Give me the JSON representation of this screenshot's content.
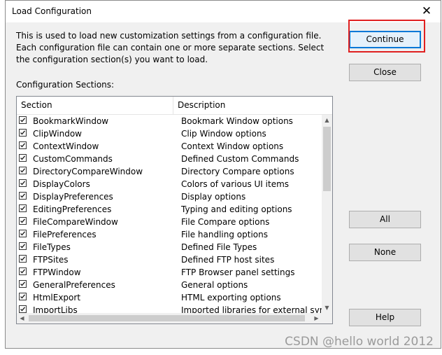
{
  "dialog": {
    "title": "Load Configuration",
    "description": "This is used to load new customization settings from a configuration file. Each configuration file can contain one or more separate sections. Select the configuration section(s) you want to load.",
    "sections_label": "Configuration Sections:",
    "columns": [
      "Section",
      "Description"
    ],
    "rows": [
      {
        "section": "BookmarkWindow",
        "description": "Bookmark Window options",
        "checked": true
      },
      {
        "section": "ClipWindow",
        "description": "Clip Window options",
        "checked": true
      },
      {
        "section": "ContextWindow",
        "description": "Context Window options",
        "checked": true
      },
      {
        "section": "CustomCommands",
        "description": "Defined Custom Commands",
        "checked": true
      },
      {
        "section": "DirectoryCompareWindow",
        "description": "Directory Compare options",
        "checked": true
      },
      {
        "section": "DisplayColors",
        "description": "Colors of various UI items",
        "checked": true
      },
      {
        "section": "DisplayPreferences",
        "description": "Display options",
        "checked": true
      },
      {
        "section": "EditingPreferences",
        "description": "Typing and editing options",
        "checked": true
      },
      {
        "section": "FileCompareWindow",
        "description": "File Compare options",
        "checked": true
      },
      {
        "section": "FilePreferences",
        "description": "File handling options",
        "checked": true
      },
      {
        "section": "FileTypes",
        "description": "Defined File Types",
        "checked": true
      },
      {
        "section": "FTPSites",
        "description": "Defined FTP host sites",
        "checked": true
      },
      {
        "section": "FTPWindow",
        "description": "FTP Browser panel settings",
        "checked": true
      },
      {
        "section": "GeneralPreferences",
        "description": "General options",
        "checked": true
      },
      {
        "section": "HtmlExport",
        "description": "HTML exporting options",
        "checked": true
      },
      {
        "section": "ImportLibs",
        "description": "Imported libraries for external syn",
        "checked": true
      }
    ],
    "buttons": {
      "continue": "Continue",
      "close": "Close",
      "all": "All",
      "none": "None",
      "help": "Help"
    },
    "close_glyph": "✕"
  },
  "watermark": "CSDN @hello world 2012",
  "colors": {
    "highlight_box": "#e02020",
    "default_button_border": "#0078d7",
    "dialog_bg": "#f0f0f0"
  }
}
